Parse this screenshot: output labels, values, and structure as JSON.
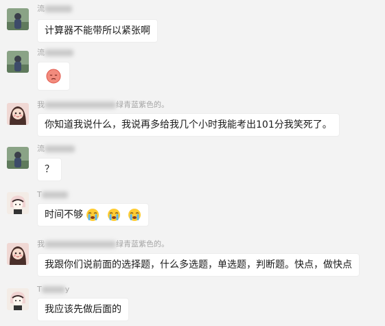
{
  "messages": [
    {
      "sender_visible": "流...",
      "text": "计算器不能带所以紧张啊"
    },
    {
      "sender_visible": "流...",
      "emoji": "disappointed-face"
    },
    {
      "sender_visible_prefix": "我",
      "sender_visible_suffix": "绿青蓝紫色的。",
      "text": "你知道我说什么，我说再多给我几个小时我能考出101分我笑死了。"
    },
    {
      "sender_visible": "流...",
      "text": "？"
    },
    {
      "sender_visible": "T...",
      "text": "时间不够",
      "emojis": [
        "loudly-crying-face",
        "loudly-crying-face",
        "loudly-crying-face"
      ]
    },
    {
      "sender_visible_prefix": "我",
      "sender_visible_suffix": "绿青蓝紫色的。",
      "text": "我跟你们说前面的选择题，什么多选题，单选题，判断题。快点，做快点"
    },
    {
      "sender_visible": "T...y",
      "text": "我应该先做后面的"
    }
  ],
  "names": {
    "n1": "流",
    "n2": "流",
    "n3_prefix": "我",
    "n3_suffix": "绿青蓝紫色的。",
    "n4": "流",
    "n5": "T",
    "n6_prefix": "我",
    "n6_suffix": "绿青蓝紫色的。",
    "n7": "T",
    "n7_end": "y"
  },
  "colors": {
    "background": "#f3f3f3",
    "bubble": "#ffffff",
    "name_text": "#a6a6a6"
  }
}
